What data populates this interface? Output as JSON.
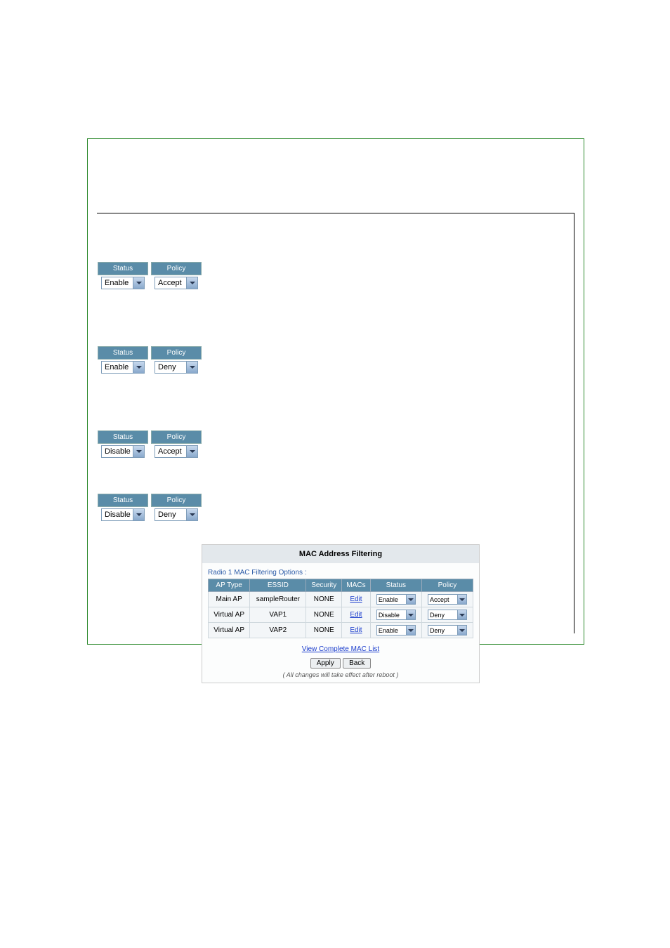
{
  "labels": {
    "status": "Status",
    "policy": "Policy"
  },
  "configs": [
    {
      "status": "Enable",
      "policy": "Accept"
    },
    {
      "status": "Enable",
      "policy": "Deny"
    },
    {
      "status": "Disable",
      "policy": "Accept"
    },
    {
      "status": "Disable",
      "policy": "Deny"
    }
  ],
  "panel": {
    "title": "MAC Address Filtering",
    "options_label": "Radio 1 MAC Filtering Options :",
    "columns": {
      "ap_type": "AP Type",
      "essid": "ESSID",
      "security": "Security",
      "macs": "MACs",
      "status": "Status",
      "policy": "Policy"
    },
    "rows": [
      {
        "ap_type": "Main AP",
        "essid": "sampleRouter",
        "security": "NONE",
        "macs": "Edit",
        "status": "Enable",
        "policy": "Accept"
      },
      {
        "ap_type": "Virtual AP",
        "essid": "VAP1",
        "security": "NONE",
        "macs": "Edit",
        "status": "Disable",
        "policy": "Deny"
      },
      {
        "ap_type": "Virtual AP",
        "essid": "VAP2",
        "security": "NONE",
        "macs": "Edit",
        "status": "Enable",
        "policy": "Deny"
      }
    ],
    "view_link": "View Complete MAC List",
    "apply": "Apply",
    "back": "Back",
    "note": "( All changes will take effect after reboot )"
  }
}
